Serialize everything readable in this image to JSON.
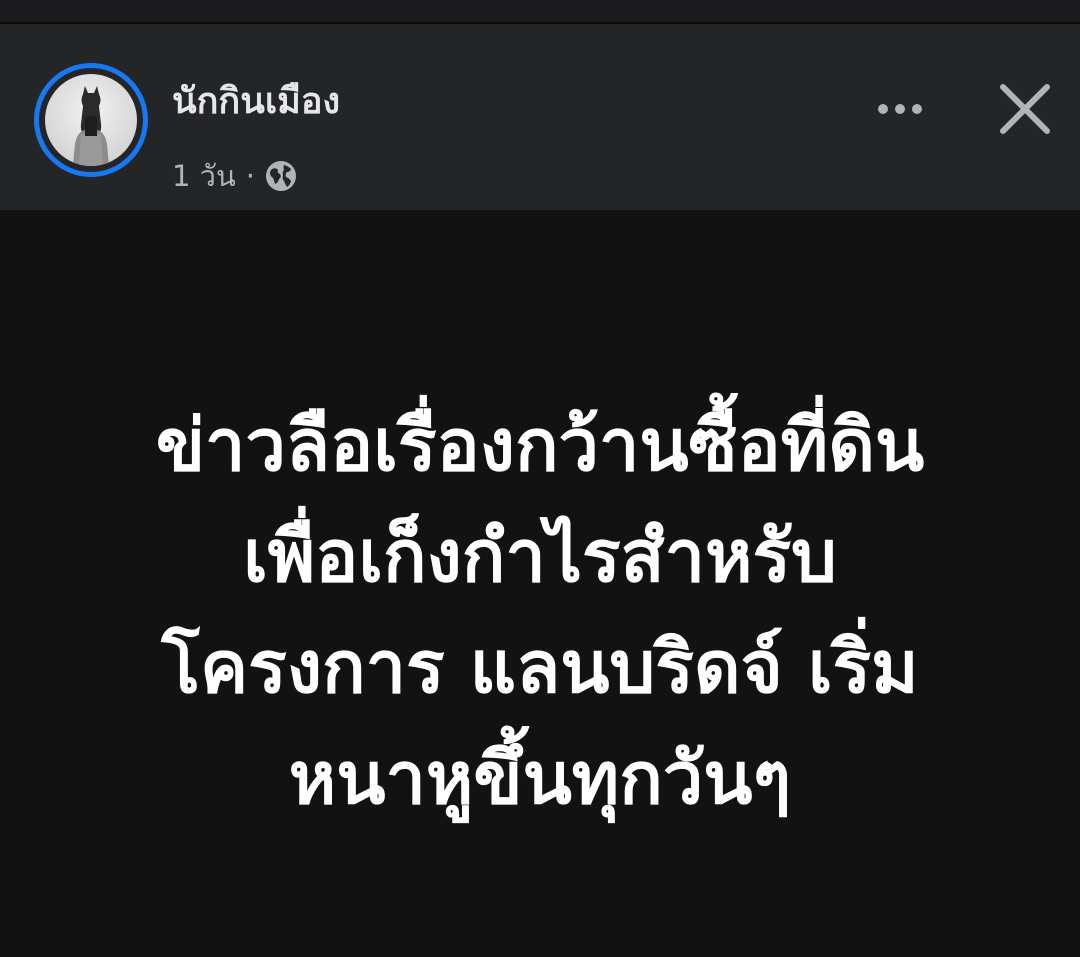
{
  "post": {
    "author": "นักกินเมือง",
    "timestamp": "1 วัน",
    "separator": "·",
    "privacy_icon": "globe-icon",
    "more_icon": "more-horizontal-icon",
    "close_icon": "close-icon",
    "body_lines": [
      "ข่าวลือเรื่องกว้านซื้อที่ดิน",
      "เพื่อเก็งกำไรสำหรับ",
      "โครงการ แลนบริดจ์ เริ่ม",
      "หนาหูขึ้นทุกวันๆ"
    ]
  },
  "colors": {
    "header_bg": "#242526",
    "body_bg": "#121212",
    "avatar_ring": "#1877f2",
    "name_text": "#e4e6eb",
    "meta_text": "#b0b3b8",
    "body_text": "#ffffff"
  }
}
